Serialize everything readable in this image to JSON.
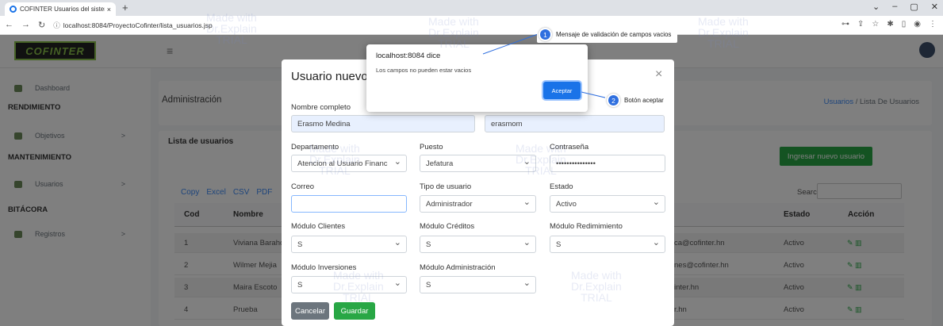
{
  "browser": {
    "tab_title": "COFINTER Usuarios del sistema",
    "tab_close": "×",
    "new_tab": "+",
    "url": "localhost:8084/ProyectoCofinter/lista_usuarios.jsp",
    "nav_icons": [
      "back-icon",
      "forward-icon",
      "reload-icon"
    ]
  },
  "app": {
    "logo": "COFINTER",
    "admin_title": "Administración",
    "breadcrumb_link": "Usuarios",
    "breadcrumb_sep": "/",
    "breadcrumb_current": "Lista De Usuarios"
  },
  "sidebar": {
    "dashboard": "Dashboard",
    "sec_rendimiento": "RENDIMIENTO",
    "objetivos": "Objetivos",
    "sec_mantenimiento": "MANTENIMIENTO",
    "usuarios": "Usuarios",
    "sec_bitacora": "BITÁCORA",
    "registros": "Registros",
    "chevron": ">"
  },
  "users": {
    "card_title": "Lista de usuarios",
    "add_button": "Ingresar nuevo usuario",
    "exports": [
      "Copy",
      "Excel",
      "CSV",
      "PDF"
    ],
    "search_label": "Search:",
    "columns": {
      "cod": "Cod",
      "nombre": "Nombre",
      "estado": "Estado",
      "accion": "Acción"
    },
    "rows": [
      {
        "cod": "1",
        "nombre": "Viviana Baraho",
        "email": "ca@cofinter.hn",
        "estado": "Activo"
      },
      {
        "cod": "2",
        "nombre": "Wilmer Mejia",
        "email": "nes@cofinter.hn",
        "estado": "Activo"
      },
      {
        "cod": "3",
        "nombre": "Maira Escoto",
        "email": "inter.hn",
        "estado": "Activo"
      },
      {
        "cod": "4",
        "nombre": "Prueba",
        "email": "r.hn",
        "estado": "Activo"
      }
    ]
  },
  "modal": {
    "title": "Usuario nuevo",
    "close": "×",
    "nombre_label": "Nombre completo",
    "nombre_value": "Erasmo Medina",
    "usuario_label": "Usuario",
    "usuario_value": "erasmom",
    "depto_label": "Departamento",
    "depto_value": "Atencion al Usuario Financ",
    "puesto_label": "Puesto",
    "puesto_value": "Jefatura",
    "pass_label": "Contraseña",
    "pass_value": "•••••••••••••••",
    "correo_label": "Correo",
    "correo_value": "",
    "tipo_label": "Tipo de usuario",
    "tipo_value": "Administrador",
    "estado_label": "Estado",
    "estado_value": "Activo",
    "mod_clientes_label": "Módulo Clientes",
    "mod_clientes_value": "S",
    "mod_creditos_label": "Módulo Créditos",
    "mod_creditos_value": "S",
    "mod_redim_label": "Módulo Redimimiento",
    "mod_redim_value": "S",
    "mod_inv_label": "Módulo Inversiones",
    "mod_inv_value": "S",
    "mod_admin_label": "Módulo Administración",
    "mod_admin_value": "S",
    "cancel": "Cancelar",
    "save": "Guardar"
  },
  "alert": {
    "host": "localhost:8084 dice",
    "message": "Los campos no pueden estar vacios",
    "ok": "Aceptar"
  },
  "callouts": [
    {
      "num": "1",
      "text": "Mensaje de validación de campos vacios"
    },
    {
      "num": "2",
      "text": "Botón aceptar"
    }
  ],
  "watermark": "Made with\nDr.Explain\nTRIAL"
}
